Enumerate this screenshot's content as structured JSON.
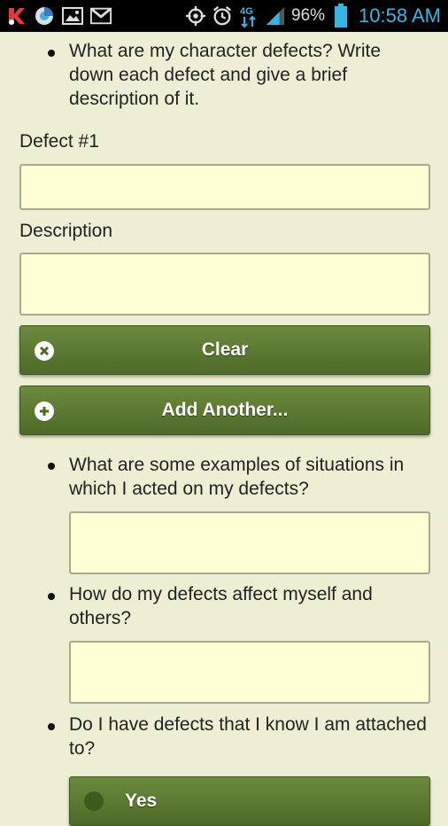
{
  "status_bar": {
    "battery_percent": "96%",
    "time": "10:58 AM",
    "network": "4G",
    "icons": [
      "k-icon",
      "update-icon",
      "gallery-icon",
      "gmail-icon",
      "gps-icon",
      "alarm-icon",
      "4g-icon",
      "signal-icon",
      "battery-icon"
    ]
  },
  "form": {
    "question_1": "What are my character defects? Write down each defect and give a brief description of it.",
    "defect_label": "Defect #1",
    "defect_value": "",
    "description_label": "Description",
    "description_value": "",
    "clear_label": "Clear",
    "add_another_label": "Add Another...",
    "question_2": "What are some examples of situations in which I acted on my defects?",
    "answer_2": "",
    "question_3": "How do my defects affect myself and others?",
    "answer_3": "",
    "question_4": "Do I have defects that I know I am attached to?",
    "yes_label": "Yes"
  },
  "colors": {
    "background": "#eeeed4",
    "field_bg": "#ffffd6",
    "button_green": "#5b7a31",
    "status_blue": "#33b5e5"
  }
}
